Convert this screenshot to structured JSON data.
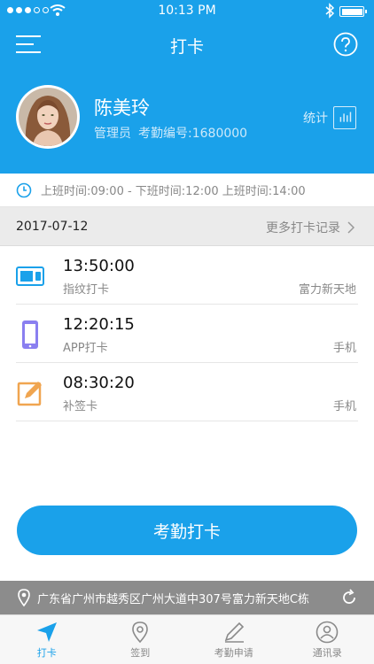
{
  "status_bar": {
    "time": "10:13 PM",
    "signal_dots": 5,
    "signal_filled": 3
  },
  "nav": {
    "title": "打卡"
  },
  "profile": {
    "name": "陈美玲",
    "role": "管理员",
    "employee_id_label": "考勤编号:1680000",
    "stats_label": "统计"
  },
  "shift": {
    "text": "上班时间:09:00 - 下班时间:12:00  上班时间:14:00"
  },
  "records_header": {
    "date": "2017-07-12",
    "more_label": "更多打卡记录"
  },
  "records": [
    {
      "time": "13:50:00",
      "type": "指纹打卡",
      "location": "富力新天地",
      "icon": "fingerprint-device-icon"
    },
    {
      "time": "12:20:15",
      "type": "APP打卡",
      "location": "手机",
      "icon": "phone-icon"
    },
    {
      "time": "08:30:20",
      "type": "补签卡",
      "location": "手机",
      "icon": "edit-icon"
    }
  ],
  "punch_button": {
    "label": "考勤打卡"
  },
  "location": {
    "address": "广东省广州市越秀区广州大道中307号富力新天地C栋"
  },
  "tabs": [
    {
      "label": "打卡",
      "icon": "navigate-arrow-icon",
      "active": true
    },
    {
      "label": "签到",
      "icon": "location-pin-icon",
      "active": false
    },
    {
      "label": "考勤申请",
      "icon": "pencil-icon",
      "active": false
    },
    {
      "label": "通讯录",
      "icon": "contact-icon",
      "active": false
    }
  ],
  "colors": {
    "primary": "#1aa1ea",
    "orange": "#f0a550",
    "purple": "#8a7ff0",
    "gray": "#8c8c8c"
  }
}
